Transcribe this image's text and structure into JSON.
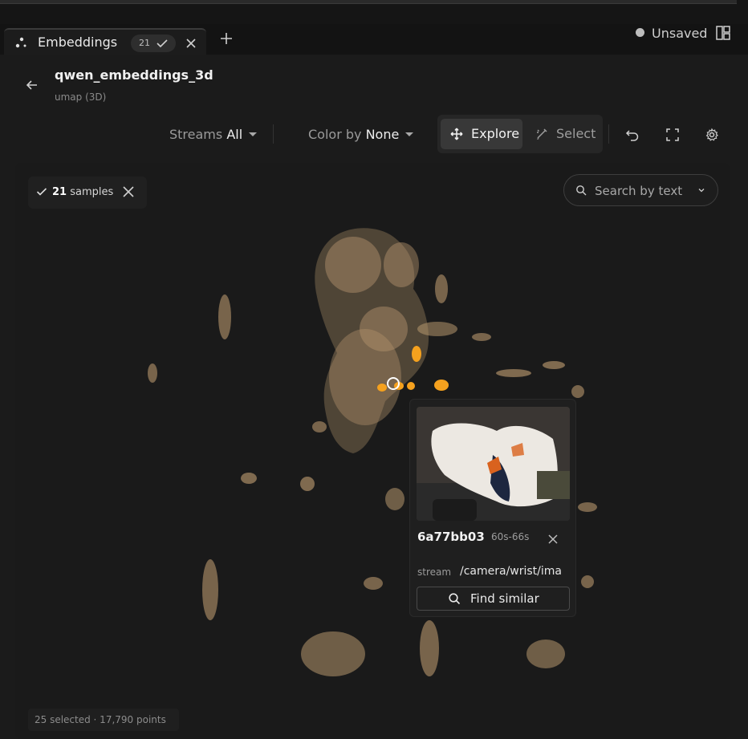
{
  "tab": {
    "label": "Embeddings",
    "badge_count": "21",
    "icon": "scatter-icon"
  },
  "header": {
    "unsaved_label": "Unsaved",
    "title": "qwen_embeddings_3d",
    "subtitle": "umap (3D)"
  },
  "toolbar": {
    "streams_label": "Streams",
    "streams_value": "All",
    "color_label": "Color by",
    "color_value": "None",
    "explore_label": "Explore",
    "select_label": "Select"
  },
  "selection": {
    "count": "21",
    "label": "samples"
  },
  "search": {
    "placeholder": "Search by text"
  },
  "popup": {
    "sample_id": "6a77bb03",
    "time_range": "60s-66s",
    "stream_key": "stream",
    "stream_value": "/camera/wrist/ima",
    "find_label": "Find similar"
  },
  "status": {
    "text": "25 selected · 17,790 points"
  },
  "colors": {
    "point": "#c9a577",
    "selected_point": "#f5a11e",
    "background": "#1a1a1a"
  }
}
